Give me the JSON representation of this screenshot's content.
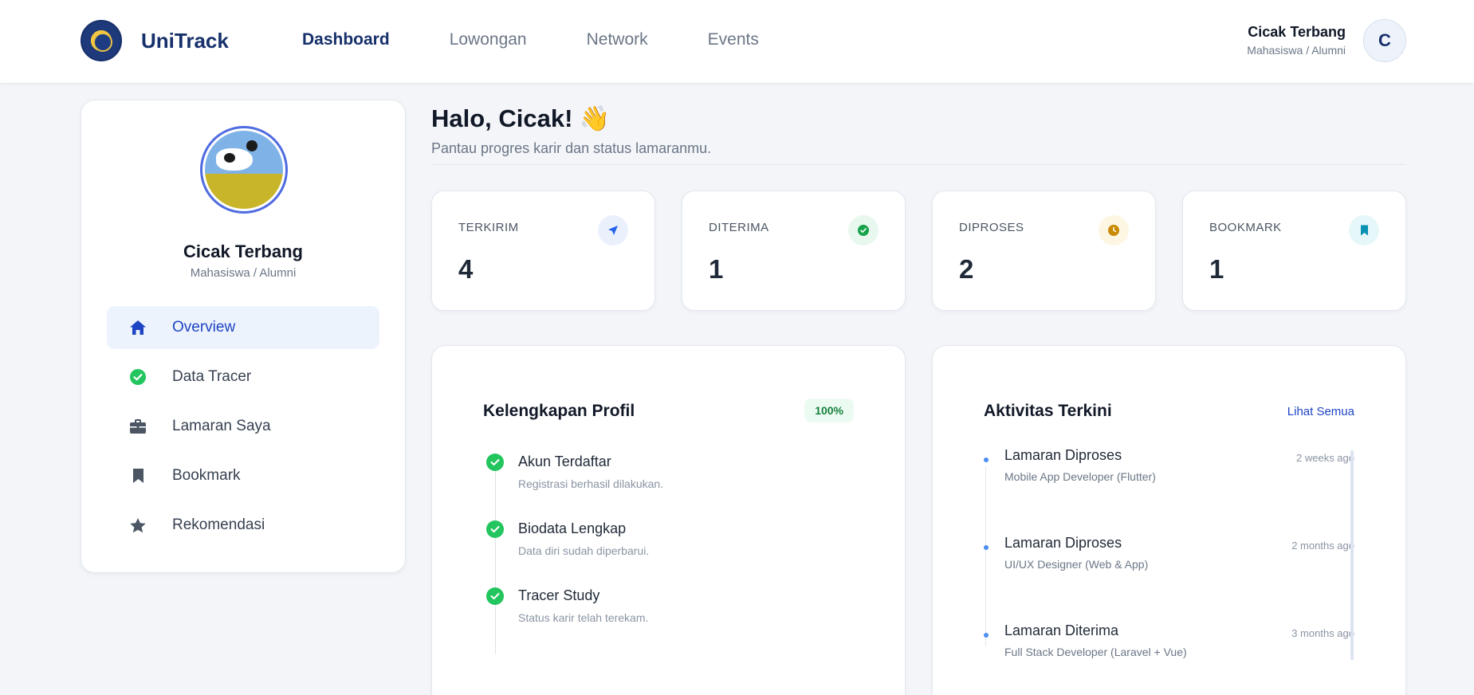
{
  "header": {
    "brand": "UniTrack",
    "nav": [
      {
        "label": "Dashboard",
        "active": true
      },
      {
        "label": "Lowongan",
        "active": false
      },
      {
        "label": "Network",
        "active": false
      },
      {
        "label": "Events",
        "active": false
      }
    ],
    "user_name": "Cicak Terbang",
    "user_role": "Mahasiswa / Alumni",
    "avatar_initial": "C"
  },
  "sidebar": {
    "name": "Cicak Terbang",
    "role": "Mahasiswa / Alumni",
    "items": [
      {
        "label": "Overview",
        "icon": "home-icon",
        "active": true
      },
      {
        "label": "Data Tracer",
        "icon": "check-circle-icon",
        "active": false
      },
      {
        "label": "Lamaran Saya",
        "icon": "briefcase-icon",
        "active": false
      },
      {
        "label": "Bookmark",
        "icon": "bookmark-icon",
        "active": false
      },
      {
        "label": "Rekomendasi",
        "icon": "star-icon",
        "active": false
      }
    ]
  },
  "main": {
    "greeting": "Halo, Cicak!",
    "greeting_emoji": "👋",
    "subtitle": "Pantau progres karir dan status lamaranmu.",
    "stats": [
      {
        "label": "TERKIRIM",
        "value": "4",
        "icon": "send-icon",
        "color": "#2563eb",
        "bg": "#eaf1fd"
      },
      {
        "label": "DITERIMA",
        "value": "1",
        "icon": "check-circle-icon",
        "color": "#16a34a",
        "bg": "#e9f8ef"
      },
      {
        "label": "DIPROSES",
        "value": "2",
        "icon": "clock-icon",
        "color": "#ca8a04",
        "bg": "#fdf6e3"
      },
      {
        "label": "BOOKMARK",
        "value": "1",
        "icon": "bookmark-icon",
        "color": "#0891b2",
        "bg": "#e6f7fa"
      }
    ],
    "profile": {
      "title": "Kelengkapan Profil",
      "percent_label": "100%",
      "steps": [
        {
          "title": "Akun Terdaftar",
          "desc": "Registrasi berhasil dilakukan."
        },
        {
          "title": "Biodata Lengkap",
          "desc": "Data diri sudah diperbarui."
        },
        {
          "title": "Tracer Study",
          "desc": "Status karir telah terekam."
        }
      ]
    },
    "activity": {
      "title": "Aktivitas Terkini",
      "see_all": "Lihat Semua",
      "items": [
        {
          "title": "Lamaran Diproses",
          "time": "2 weeks ago",
          "desc": "Mobile App Developer (Flutter)"
        },
        {
          "title": "Lamaran Diproses",
          "time": "2 months ago",
          "desc": "UI/UX Designer (Web & App)"
        },
        {
          "title": "Lamaran Diterima",
          "time": "3 months ago",
          "desc": "Full Stack Developer (Laravel + Vue)"
        }
      ]
    }
  }
}
